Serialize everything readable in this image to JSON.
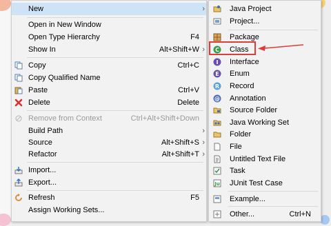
{
  "main_menu": {
    "items": [
      {
        "label": "New",
        "shortcut": "",
        "arrow": "›",
        "icon": "none",
        "disabled": false
      },
      {
        "label": "Open in New Window",
        "shortcut": "",
        "arrow": "",
        "icon": "none",
        "disabled": false
      },
      {
        "label": "Open Type Hierarchy",
        "shortcut": "F4",
        "arrow": "",
        "icon": "none",
        "disabled": false
      },
      {
        "label": "Show In",
        "shortcut": "Alt+Shift+W",
        "arrow": "›",
        "icon": "none",
        "disabled": false
      },
      {
        "label": "Copy",
        "shortcut": "Ctrl+C",
        "arrow": "",
        "icon": "copy-icon",
        "disabled": false
      },
      {
        "label": "Copy Qualified Name",
        "shortcut": "",
        "arrow": "",
        "icon": "copy-icon",
        "disabled": false
      },
      {
        "label": "Paste",
        "shortcut": "Ctrl+V",
        "arrow": "",
        "icon": "paste-icon",
        "disabled": false
      },
      {
        "label": "Delete",
        "shortcut": "Delete",
        "arrow": "",
        "icon": "delete-icon",
        "disabled": false
      },
      {
        "label": "Remove from Context",
        "shortcut": "Ctrl+Alt+Shift+Down",
        "arrow": "",
        "icon": "remove-context-icon",
        "disabled": true
      },
      {
        "label": "Build Path",
        "shortcut": "",
        "arrow": "›",
        "icon": "none",
        "disabled": false
      },
      {
        "label": "Source",
        "shortcut": "Alt+Shift+S",
        "arrow": "›",
        "icon": "none",
        "disabled": false
      },
      {
        "label": "Refactor",
        "shortcut": "Alt+Shift+T",
        "arrow": "›",
        "icon": "none",
        "disabled": false
      },
      {
        "label": "Import...",
        "shortcut": "",
        "arrow": "",
        "icon": "import-icon",
        "disabled": false
      },
      {
        "label": "Export...",
        "shortcut": "",
        "arrow": "",
        "icon": "export-icon",
        "disabled": false
      },
      {
        "label": "Refresh",
        "shortcut": "F5",
        "arrow": "",
        "icon": "refresh-icon",
        "disabled": false
      },
      {
        "label": "Assign Working Sets...",
        "shortcut": "",
        "arrow": "",
        "icon": "none",
        "disabled": false
      }
    ]
  },
  "sub_menu": {
    "items": [
      {
        "label": "Java Project",
        "shortcut": "",
        "icon": "java-project-icon"
      },
      {
        "label": "Project...",
        "shortcut": "",
        "icon": "project-icon"
      },
      {
        "label": "Package",
        "shortcut": "",
        "icon": "package-icon"
      },
      {
        "label": "Class",
        "shortcut": "",
        "icon": "class-icon"
      },
      {
        "label": "Interface",
        "shortcut": "",
        "icon": "interface-icon"
      },
      {
        "label": "Enum",
        "shortcut": "",
        "icon": "enum-icon"
      },
      {
        "label": "Record",
        "shortcut": "",
        "icon": "record-icon"
      },
      {
        "label": "Annotation",
        "shortcut": "",
        "icon": "annotation-icon"
      },
      {
        "label": "Source Folder",
        "shortcut": "",
        "icon": "source-folder-icon"
      },
      {
        "label": "Java Working Set",
        "shortcut": "",
        "icon": "working-set-icon"
      },
      {
        "label": "Folder",
        "shortcut": "",
        "icon": "folder-icon"
      },
      {
        "label": "File",
        "shortcut": "",
        "icon": "file-icon"
      },
      {
        "label": "Untitled Text File",
        "shortcut": "",
        "icon": "text-file-icon"
      },
      {
        "label": "Task",
        "shortcut": "",
        "icon": "task-icon"
      },
      {
        "label": "JUnit Test Case",
        "shortcut": "",
        "icon": "junit-icon"
      },
      {
        "label": "Example...",
        "shortcut": "",
        "icon": "example-icon"
      },
      {
        "label": "Other...",
        "shortcut": "Ctrl+N",
        "icon": "other-icon"
      }
    ]
  },
  "colors": {
    "menu_bg": "#f2f2f2",
    "highlight": "#e53935",
    "disabled_text": "#9a9a9a"
  }
}
